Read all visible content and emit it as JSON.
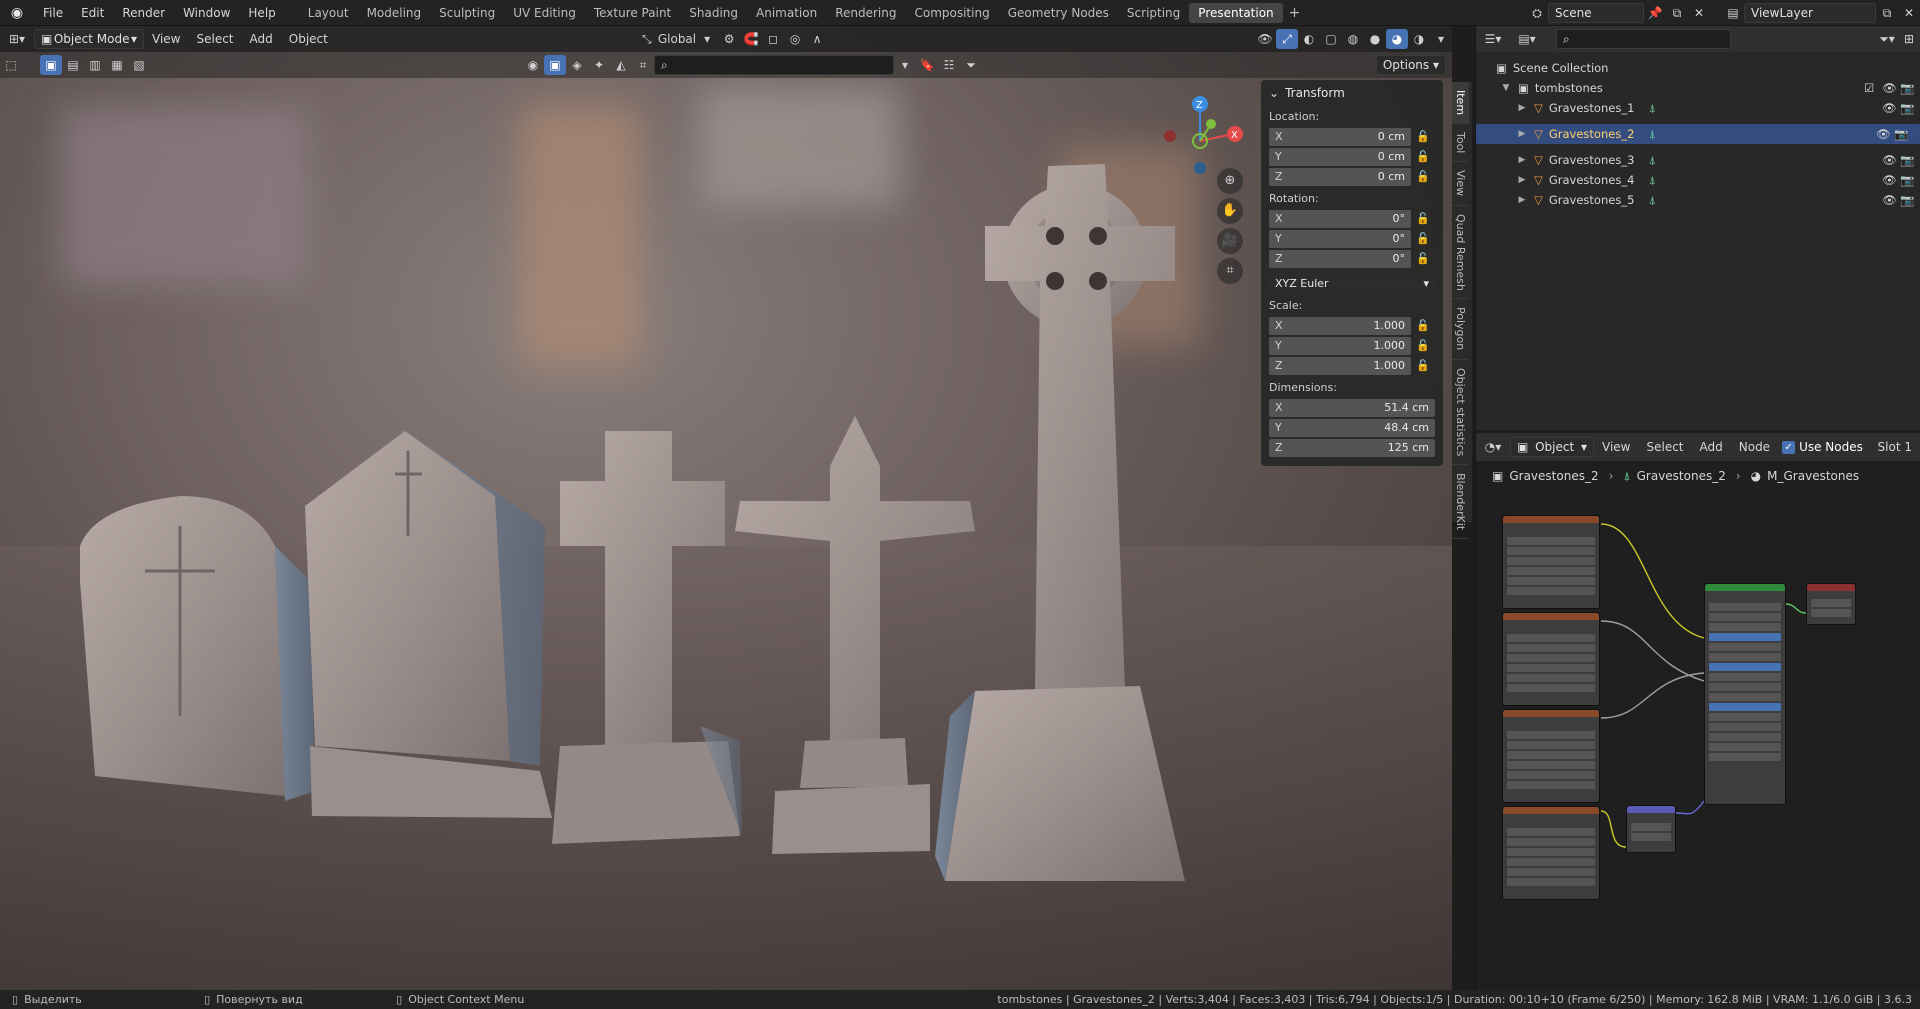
{
  "topbar": {
    "menus": [
      "File",
      "Edit",
      "Render",
      "Window",
      "Help"
    ],
    "workspaces": [
      "Layout",
      "Modeling",
      "Sculpting",
      "UV Editing",
      "Texture Paint",
      "Shading",
      "Animation",
      "Rendering",
      "Compositing",
      "Geometry Nodes",
      "Scripting",
      "Presentation"
    ],
    "active_workspace": "Presentation",
    "scene": "Scene",
    "view_layer": "ViewLayer"
  },
  "viewport_header": {
    "mode": "Object Mode",
    "menus": [
      "View",
      "Select",
      "Add",
      "Object"
    ],
    "orientation": "Global",
    "options": "Options"
  },
  "side_tabs": [
    "Item",
    "Tool",
    "View",
    "Quad Remesh",
    "Polygon",
    "Object statistics",
    "BlenderKit"
  ],
  "transform": {
    "title": "Transform",
    "location_label": "Location:",
    "location": [
      {
        "axis": "X",
        "value": "0 cm"
      },
      {
        "axis": "Y",
        "value": "0 cm"
      },
      {
        "axis": "Z",
        "value": "0 cm"
      }
    ],
    "rotation_label": "Rotation:",
    "rotation": [
      {
        "axis": "X",
        "value": "0°"
      },
      {
        "axis": "Y",
        "value": "0°"
      },
      {
        "axis": "Z",
        "value": "0°"
      }
    ],
    "rotation_mode": "XYZ Euler",
    "scale_label": "Scale:",
    "scale": [
      {
        "axis": "X",
        "value": "1.000"
      },
      {
        "axis": "Y",
        "value": "1.000"
      },
      {
        "axis": "Z",
        "value": "1.000"
      }
    ],
    "dimensions_label": "Dimensions:",
    "dimensions": [
      {
        "axis": "X",
        "value": "51.4 cm"
      },
      {
        "axis": "Y",
        "value": "48.4 cm"
      },
      {
        "axis": "Z",
        "value": "125 cm"
      }
    ]
  },
  "gizmo": {
    "z": "Z",
    "x": "X"
  },
  "outliner": {
    "root": "Scene Collection",
    "collection": "tombstones",
    "items": [
      "Gravestones_1",
      "Gravestones_2",
      "Gravestones_3",
      "Gravestones_4",
      "Gravestones_5"
    ],
    "selected": "Gravestones_2"
  },
  "node_editor": {
    "type": "Object",
    "menus": [
      "View",
      "Select",
      "Add",
      "Node"
    ],
    "use_nodes": "Use Nodes",
    "slot": "Slot 1",
    "breadcrumb": [
      "Gravestones_2",
      "Gravestones_2",
      "M_Gravestones"
    ]
  },
  "status": {
    "left1": "Выделить",
    "left2": "Повернуть вид",
    "left3": "Object Context Menu",
    "right": "tombstones | Gravestones_2 | Verts:3,404 | Faces:3,403 | Tris:6,794 | Objects:1/5 | Duration: 00:10+10 (Frame 6/250) | Memory: 162.8 MiB | VRAM: 1.1/6.0 GiB | 3.6.3"
  },
  "colors": {
    "accent": "#4772b3",
    "selected_row": "#334d80",
    "gizmo_x": "#e44b4b",
    "gizmo_y": "#7fbf3b",
    "gizmo_z": "#3b8ee4"
  }
}
